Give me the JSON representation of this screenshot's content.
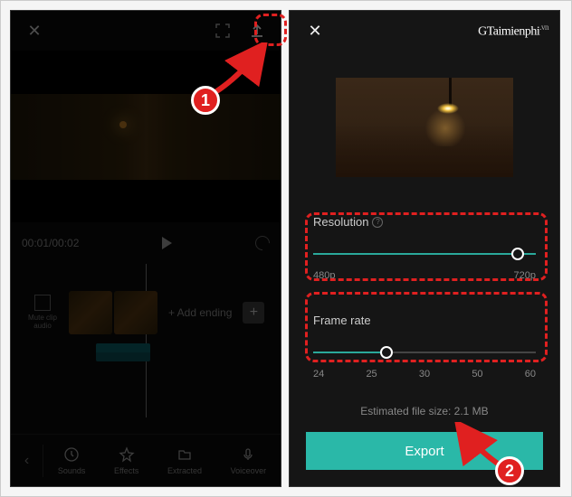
{
  "watermark": "Taimienphi",
  "watermark_suffix": ".vn",
  "left": {
    "timecode": "00:01/00:02",
    "add_ending": "+ Add ending",
    "mute_label": "Mute clip audio",
    "tools": {
      "sounds": "Sounds",
      "effects": "Effects",
      "extracted": "Extracted",
      "voiceover": "Voiceover"
    }
  },
  "right": {
    "resolution": {
      "label": "Resolution",
      "min": "480p",
      "max": "720p"
    },
    "frame_rate": {
      "label": "Frame rate",
      "ticks": [
        "24",
        "25",
        "30",
        "50",
        "60"
      ]
    },
    "filesize": "Estimated file size: 2.1 MB",
    "export_label": "Export"
  },
  "annotations": {
    "badge1": "1",
    "badge2": "2"
  }
}
